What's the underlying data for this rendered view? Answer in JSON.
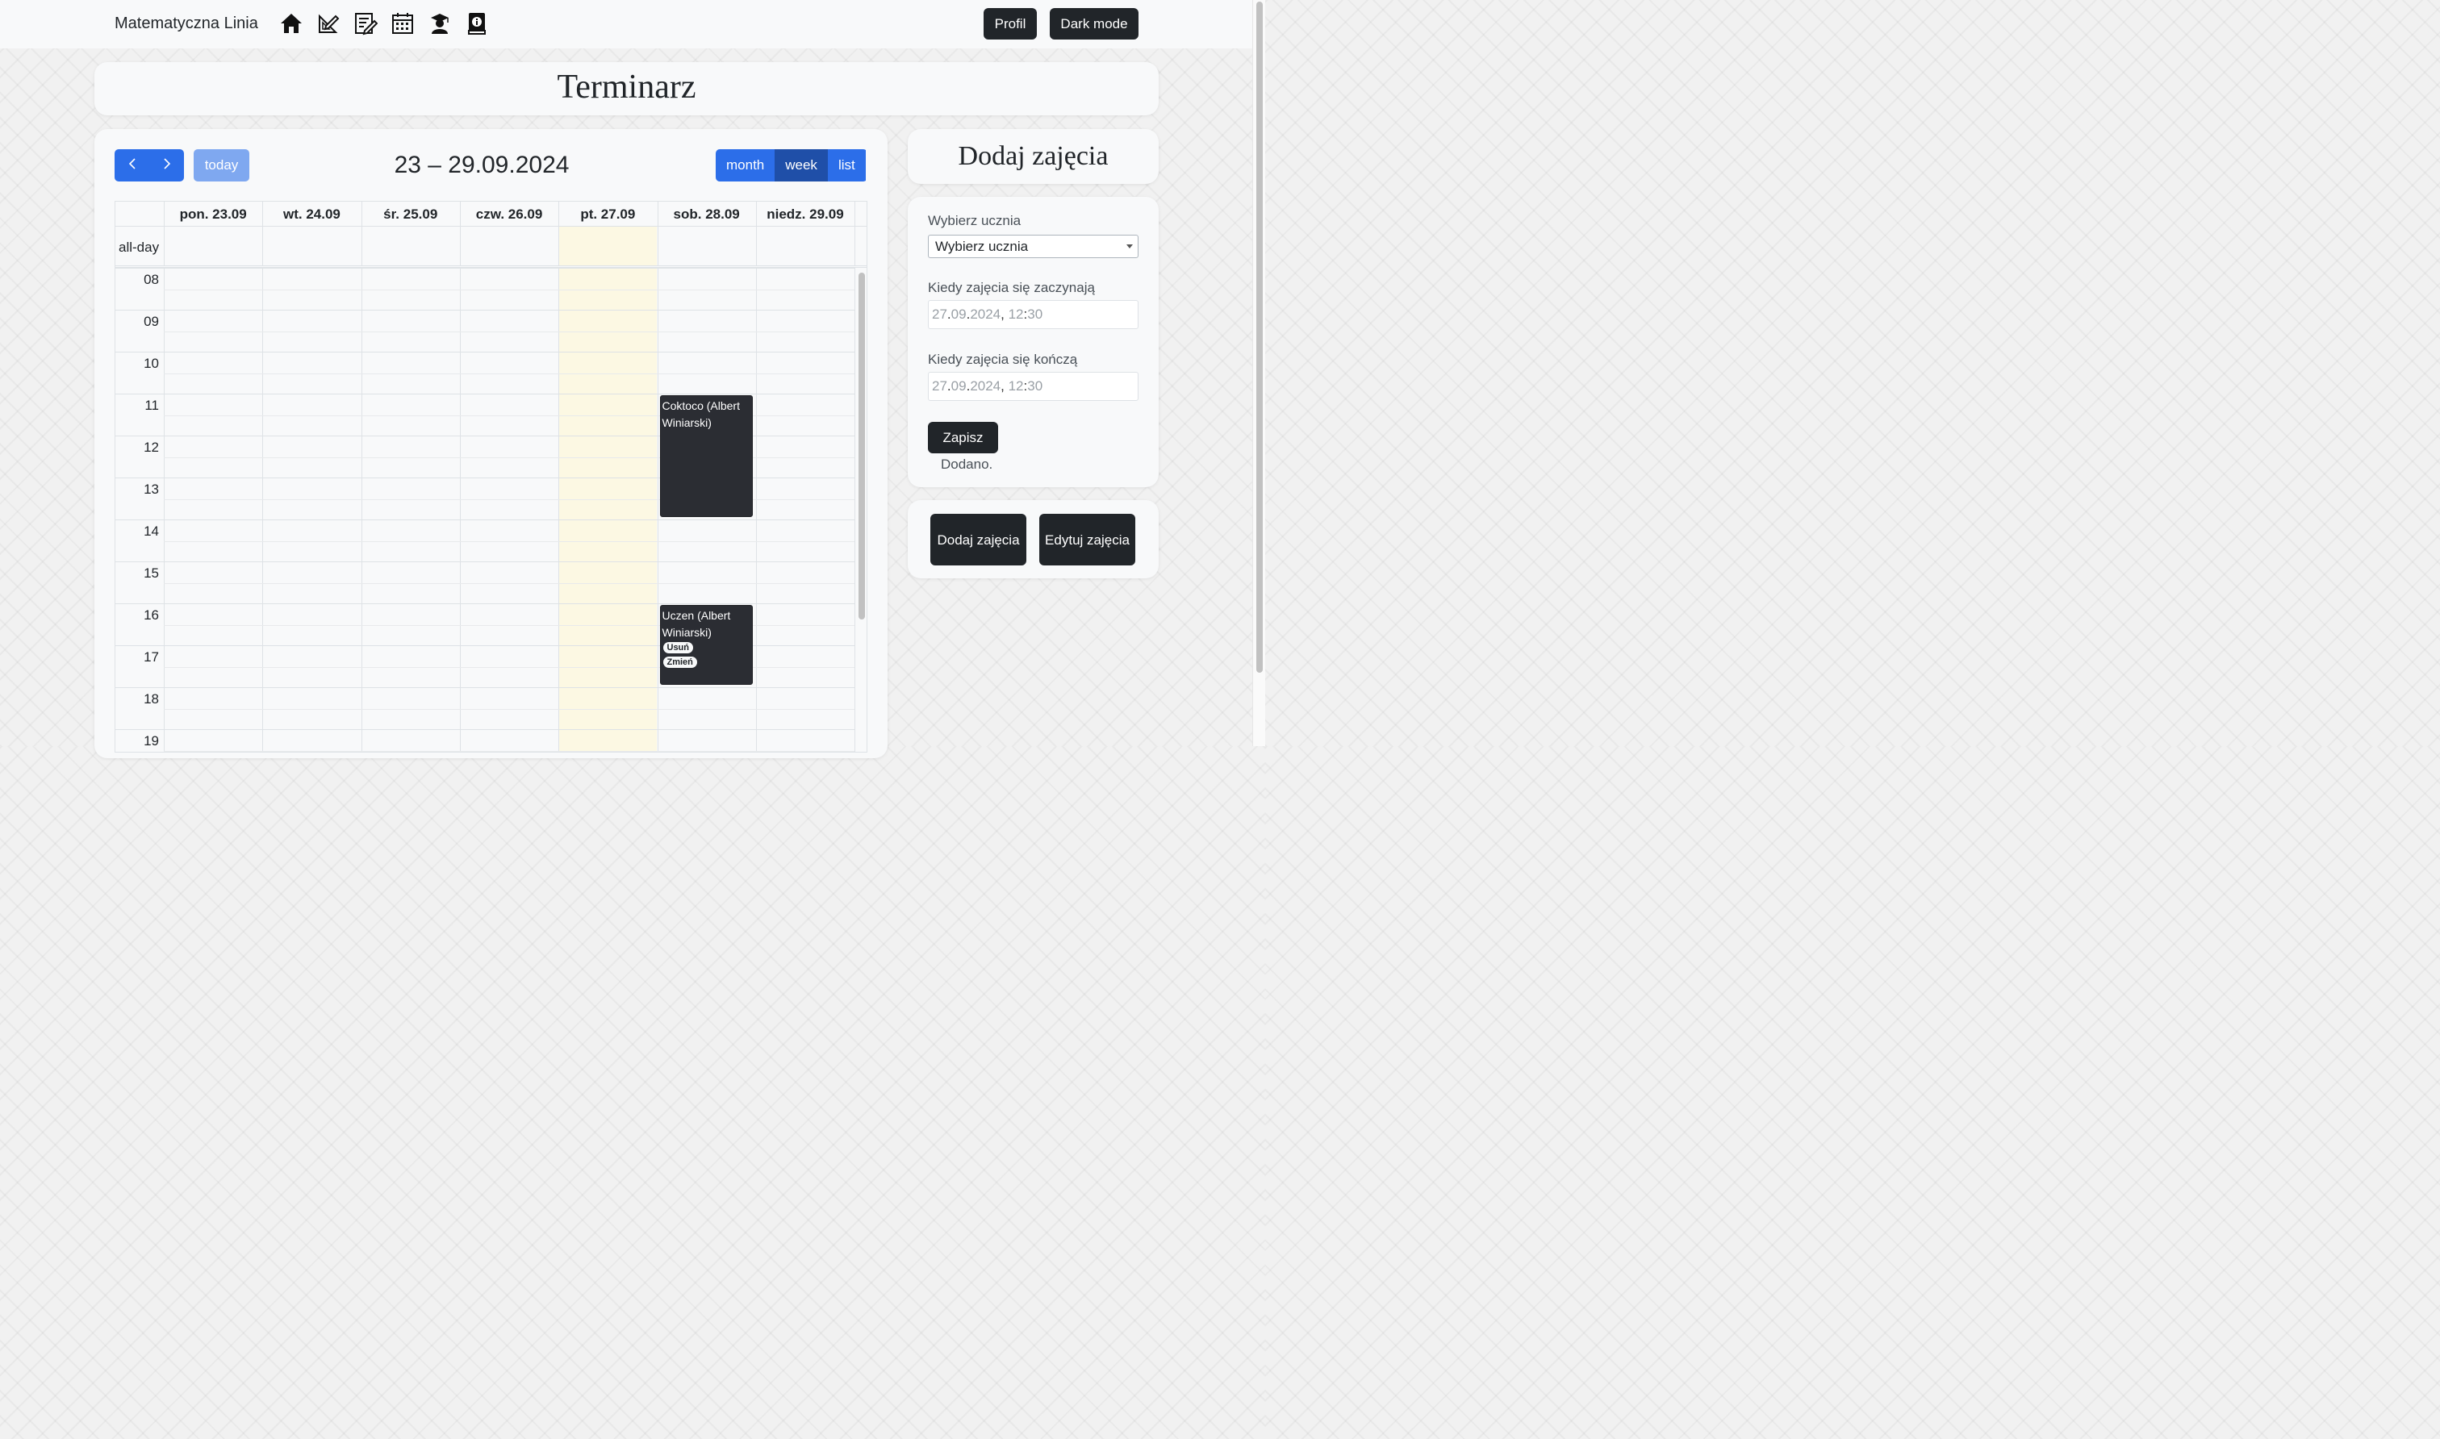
{
  "navbar": {
    "brand": "Matematyczna Linia",
    "icons": [
      "home-icon",
      "pencil-ruler-icon",
      "note-edit-icon",
      "calendar-icon",
      "student-icon",
      "info-book-icon"
    ],
    "profil_label": "Profil",
    "dark_mode_label": "Dark mode"
  },
  "page": {
    "title": "Terminarz"
  },
  "calendar": {
    "prev_label": "<",
    "next_label": ">",
    "today_label": "today",
    "range_title": "23 – 29.09.2024",
    "views": [
      "month",
      "week",
      "list"
    ],
    "active_view": "week",
    "days": [
      "pon. 23.09",
      "wt. 24.09",
      "śr. 25.09",
      "czw. 26.09",
      "pt. 27.09",
      "sob. 28.09",
      "niedz. 29.09"
    ],
    "today_index": 4,
    "allday_label": "all-day",
    "hours": [
      "08",
      "09",
      "10",
      "11",
      "12",
      "13",
      "14",
      "15",
      "16",
      "17",
      "18",
      "19"
    ],
    "events": [
      {
        "title": "Coktoco (Albert Winiarski)",
        "day_index": 5,
        "start": 11.0,
        "end": 14.0,
        "actions": []
      },
      {
        "title": "Uczen (Albert Winiarski)",
        "day_index": 5,
        "start": 16.0,
        "end": 18.0,
        "actions": [
          "Usuń",
          "Zmień"
        ]
      }
    ],
    "colors": {
      "primary": "#2c6ee9",
      "active": "#1f4fa8",
      "today_bg": "#fcf8e3",
      "event_bg": "#2b2d33"
    }
  },
  "add_panel": {
    "title": "Dodaj zajęcia",
    "student_label": "Wybierz ucznia",
    "student_selected": "Wybierz ucznia",
    "start_label": "Kiedy zajęcia się zaczynają",
    "start_value": {
      "day": "27",
      "month": "09",
      "year": "2024",
      "hour": "12",
      "minute": "30"
    },
    "end_label": "Kiedy zajęcia się kończą",
    "end_value": {
      "day": "27",
      "month": "09",
      "year": "2024",
      "hour": "12",
      "minute": "30"
    },
    "save_label": "Zapisz",
    "status_message": "Dodano."
  },
  "actions": {
    "add_label": "Dodaj zajęcia",
    "edit_label": "Edytuj zajęcia"
  }
}
